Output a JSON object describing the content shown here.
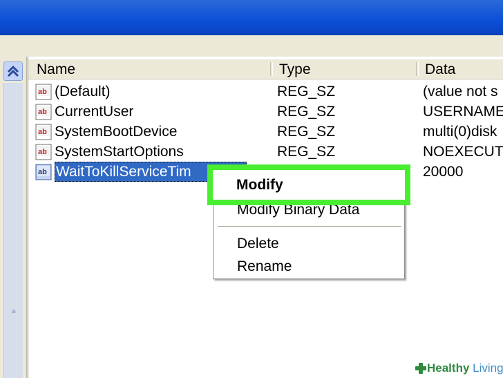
{
  "colors": {
    "titlebar": "#0b4fd9",
    "selection": "#316ac5",
    "highlight_frame": "#49ee31",
    "watermark_green": "#2f8a3f",
    "watermark_blue": "#3d8cc4"
  },
  "columns": {
    "name": "Name",
    "type": "Type",
    "data": "Data"
  },
  "rows": [
    {
      "icon": "string-value-icon",
      "name": "(Default)",
      "type": "REG_SZ",
      "data": "(value not s"
    },
    {
      "icon": "string-value-icon",
      "name": "CurrentUser",
      "type": "REG_SZ",
      "data": "USERNAME"
    },
    {
      "icon": "string-value-icon",
      "name": "SystemBootDevice",
      "type": "REG_SZ",
      "data": "multi(0)disk"
    },
    {
      "icon": "string-value-icon",
      "name": "SystemStartOptions",
      "type": "REG_SZ",
      "data": "NOEXECUTE"
    },
    {
      "icon": "string-value-icon",
      "name": "WaitToKillServiceTim",
      "type": "",
      "data": "20000",
      "selected": true
    }
  ],
  "context_menu": {
    "modify": "Modify",
    "modify_binary": "Modify Binary Data",
    "delete": "Delete",
    "rename": "Rename"
  },
  "watermark": {
    "part1": "Healthy",
    "part2": "Living"
  }
}
